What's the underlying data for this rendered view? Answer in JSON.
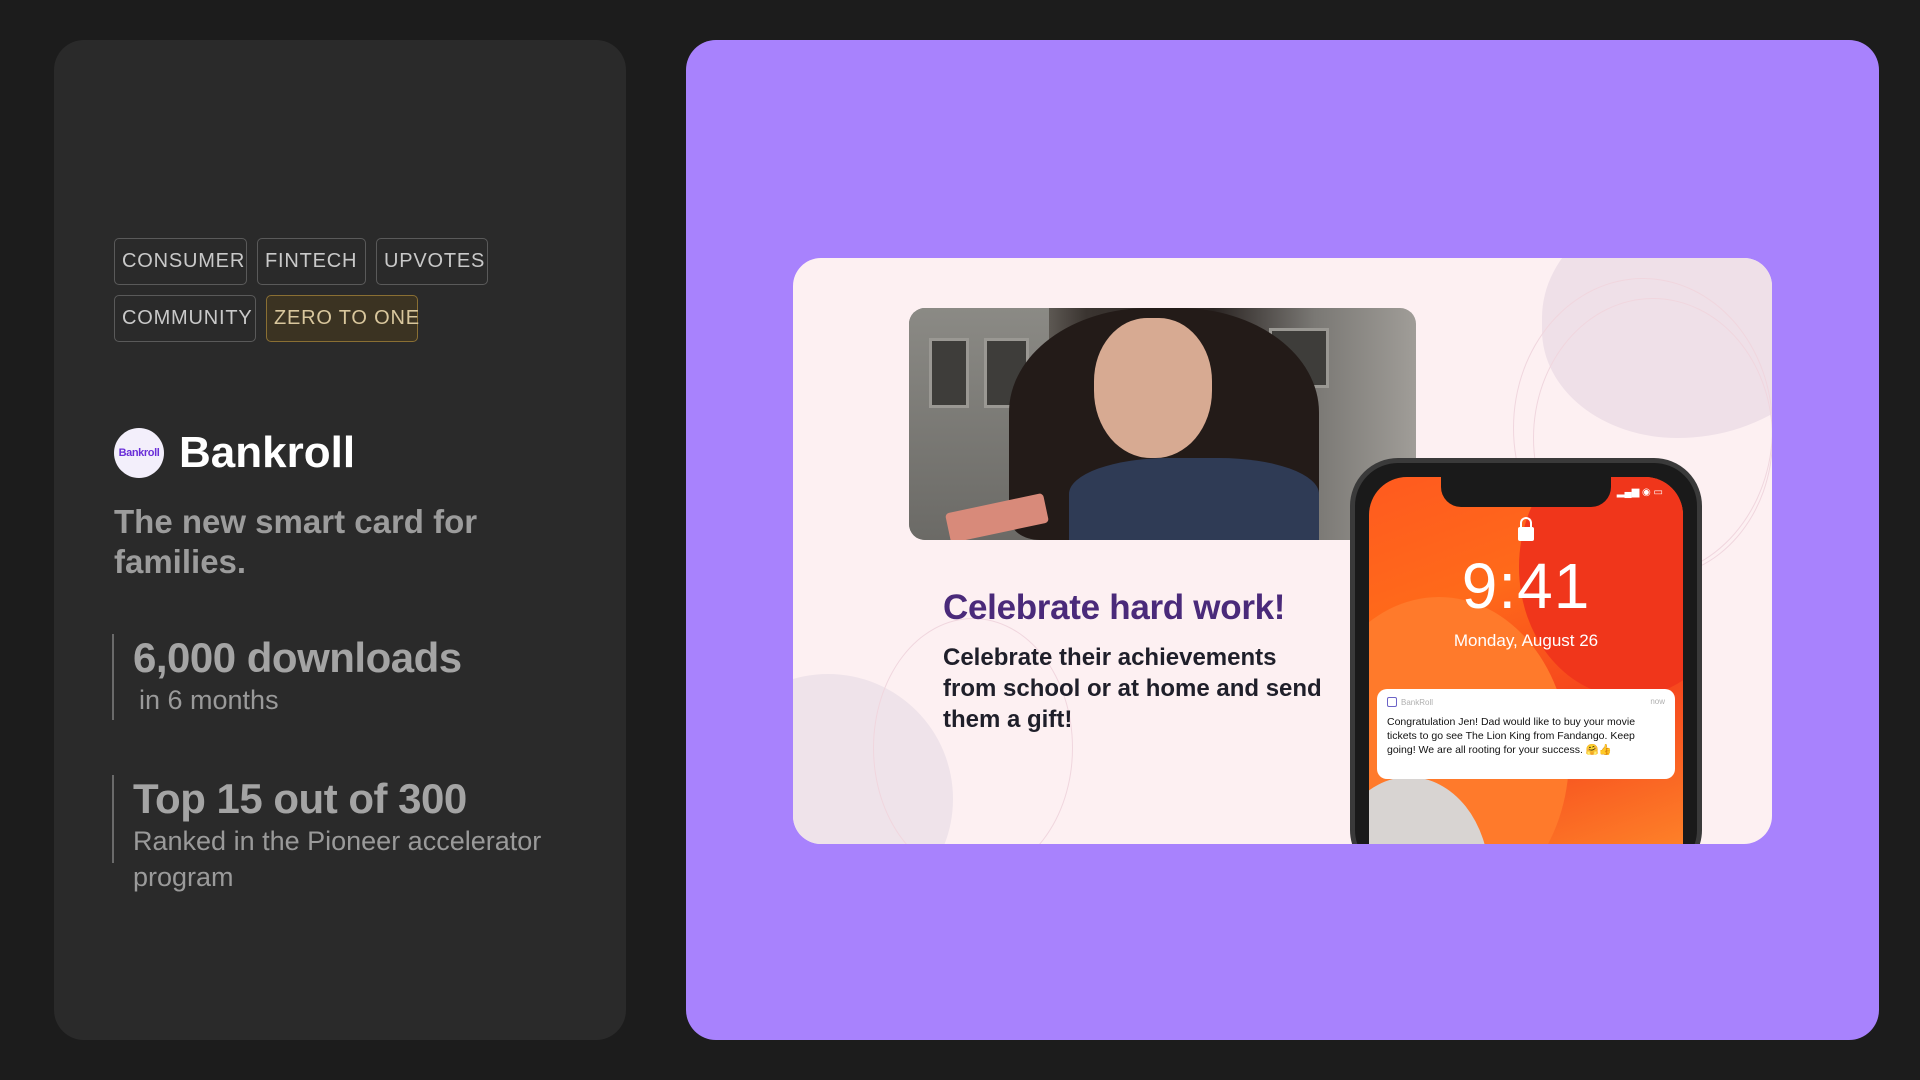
{
  "tags": [
    {
      "label": "CONSUMER",
      "highlight": false
    },
    {
      "label": "FINTECH",
      "highlight": false
    },
    {
      "label": "UPVOTES",
      "highlight": false
    },
    {
      "label": "COMMUNITY",
      "highlight": false
    },
    {
      "label": "ZERO TO ONE",
      "highlight": true
    }
  ],
  "brand": {
    "logo_text": "Bankroll",
    "name": "Bankroll",
    "tagline": "The new smart card for families."
  },
  "stats": [
    {
      "headline": "6,000 downloads",
      "sub": "in 6 months"
    },
    {
      "headline": "Top 15 out of 300",
      "sub": "Ranked in the Pioneer accelerator program"
    }
  ],
  "slide": {
    "headline": "Celebrate hard work!",
    "body": "Celebrate their achievements from school or at home and send them a gift!",
    "phone": {
      "time": "9:41",
      "date": "Monday, August 26",
      "notification": {
        "app": "BankRoll",
        "when": "now",
        "text": "Congratulation Jen! Dad would like to buy your movie tickets to go see The Lion King from Fandango. Keep going! We are all rooting for your success. 🤗👍"
      }
    }
  },
  "colors": {
    "page_bg": "#1c1c1c",
    "card_bg": "#2a2a2a",
    "panel_bg": "#a882fd",
    "slide_bg": "#fdf0f2",
    "headline_purple": "#4a2a7a",
    "highlight_tag": "#d9c79d"
  }
}
